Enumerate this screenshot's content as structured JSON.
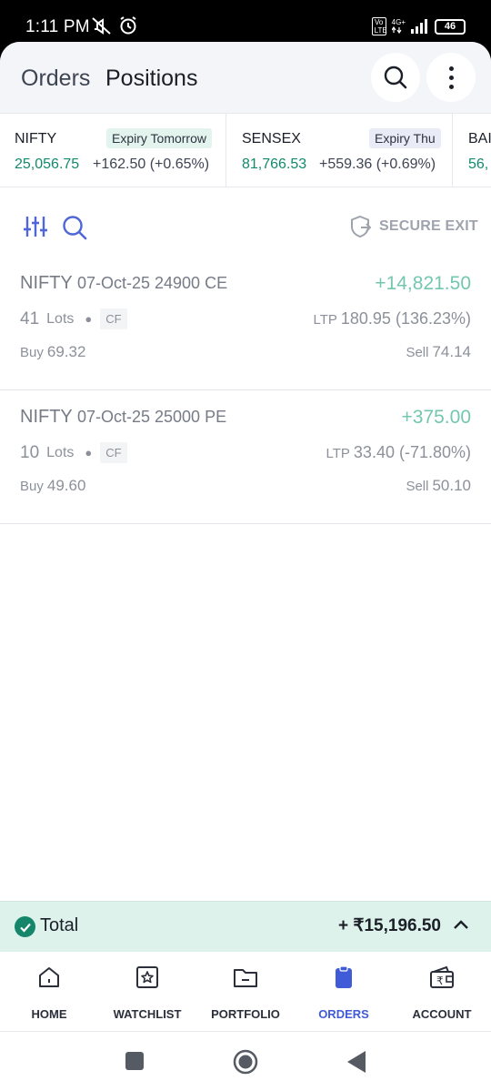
{
  "status_bar": {
    "time": "1:11 PM",
    "volte_label": "Vo LTE",
    "network": "4G+",
    "battery": "46"
  },
  "header": {
    "tabs": [
      {
        "label": "Orders",
        "active": false
      },
      {
        "label": "Positions",
        "active": true
      }
    ]
  },
  "indices": [
    {
      "name": "NIFTY",
      "expiry": "Expiry Tomorrow",
      "price": "25,056.75",
      "change": "+162.50 (+0.65%)"
    },
    {
      "name": "SENSEX",
      "expiry": "Expiry Thu",
      "price": "81,766.53",
      "change": "+559.36 (+0.69%)"
    },
    {
      "name": "BAI",
      "price": "56,"
    }
  ],
  "toolbar": {
    "secure_exit_label": "SECURE EXIT"
  },
  "positions": [
    {
      "symbol": "NIFTY",
      "contract": "07-Oct-25 24900 CE",
      "pnl": "+14,821.50",
      "lots": "41",
      "lots_label": "Lots",
      "badge": "CF",
      "ltp_label": "LTP",
      "ltp": "180.95 (136.23%)",
      "buy_label": "Buy",
      "buy": "69.32",
      "sell_label": "Sell",
      "sell": "74.14"
    },
    {
      "symbol": "NIFTY",
      "contract": "07-Oct-25 25000 PE",
      "pnl": "+375.00",
      "lots": "10",
      "lots_label": "Lots",
      "badge": "CF",
      "ltp_label": "LTP",
      "ltp": "33.40 (-71.80%)",
      "buy_label": "Buy",
      "buy": "49.60",
      "sell_label": "Sell",
      "sell": "50.10"
    }
  ],
  "total": {
    "label": "Total",
    "value": "+ ₹15,196.50"
  },
  "bottom_nav": [
    {
      "label": "HOME",
      "icon": "home-icon"
    },
    {
      "label": "WATCHLIST",
      "icon": "star-icon"
    },
    {
      "label": "PORTFOLIO",
      "icon": "folder-icon"
    },
    {
      "label": "ORDERS",
      "icon": "clipboard-icon",
      "active": true
    },
    {
      "label": "ACCOUNT",
      "icon": "wallet-icon"
    }
  ],
  "colors": {
    "green": "#138a6b",
    "pnl_green": "#73c7ae",
    "accent_blue": "#3f5bd8",
    "total_bg": "#def2ec"
  }
}
